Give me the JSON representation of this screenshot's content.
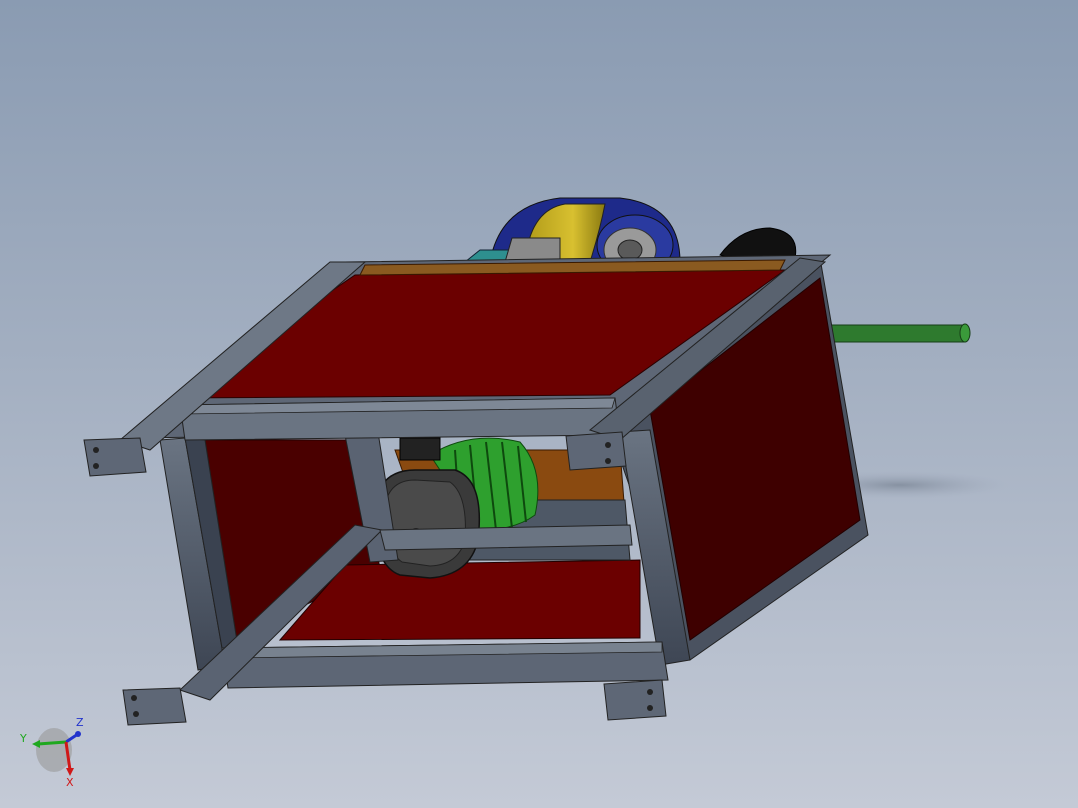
{
  "viewport": {
    "background_top": "#8a9bb2",
    "background_bottom": "#c4cad6"
  },
  "model": {
    "frame_color": "#4b5563",
    "panel_color": "#6b0000",
    "shaft_color": "#2f7a2f",
    "motor_color": "#3a3a3a",
    "motor_fins_color": "#2ea02e",
    "wheel_colors": [
      "#c8b020",
      "#2a3a9a",
      "#2e9a9a"
    ]
  },
  "triad": {
    "axis_y": "Y",
    "axis_z": "Z",
    "axis_x": "X",
    "color_y": "#1fa81f",
    "color_z": "#2233cc",
    "color_x": "#d01818"
  }
}
